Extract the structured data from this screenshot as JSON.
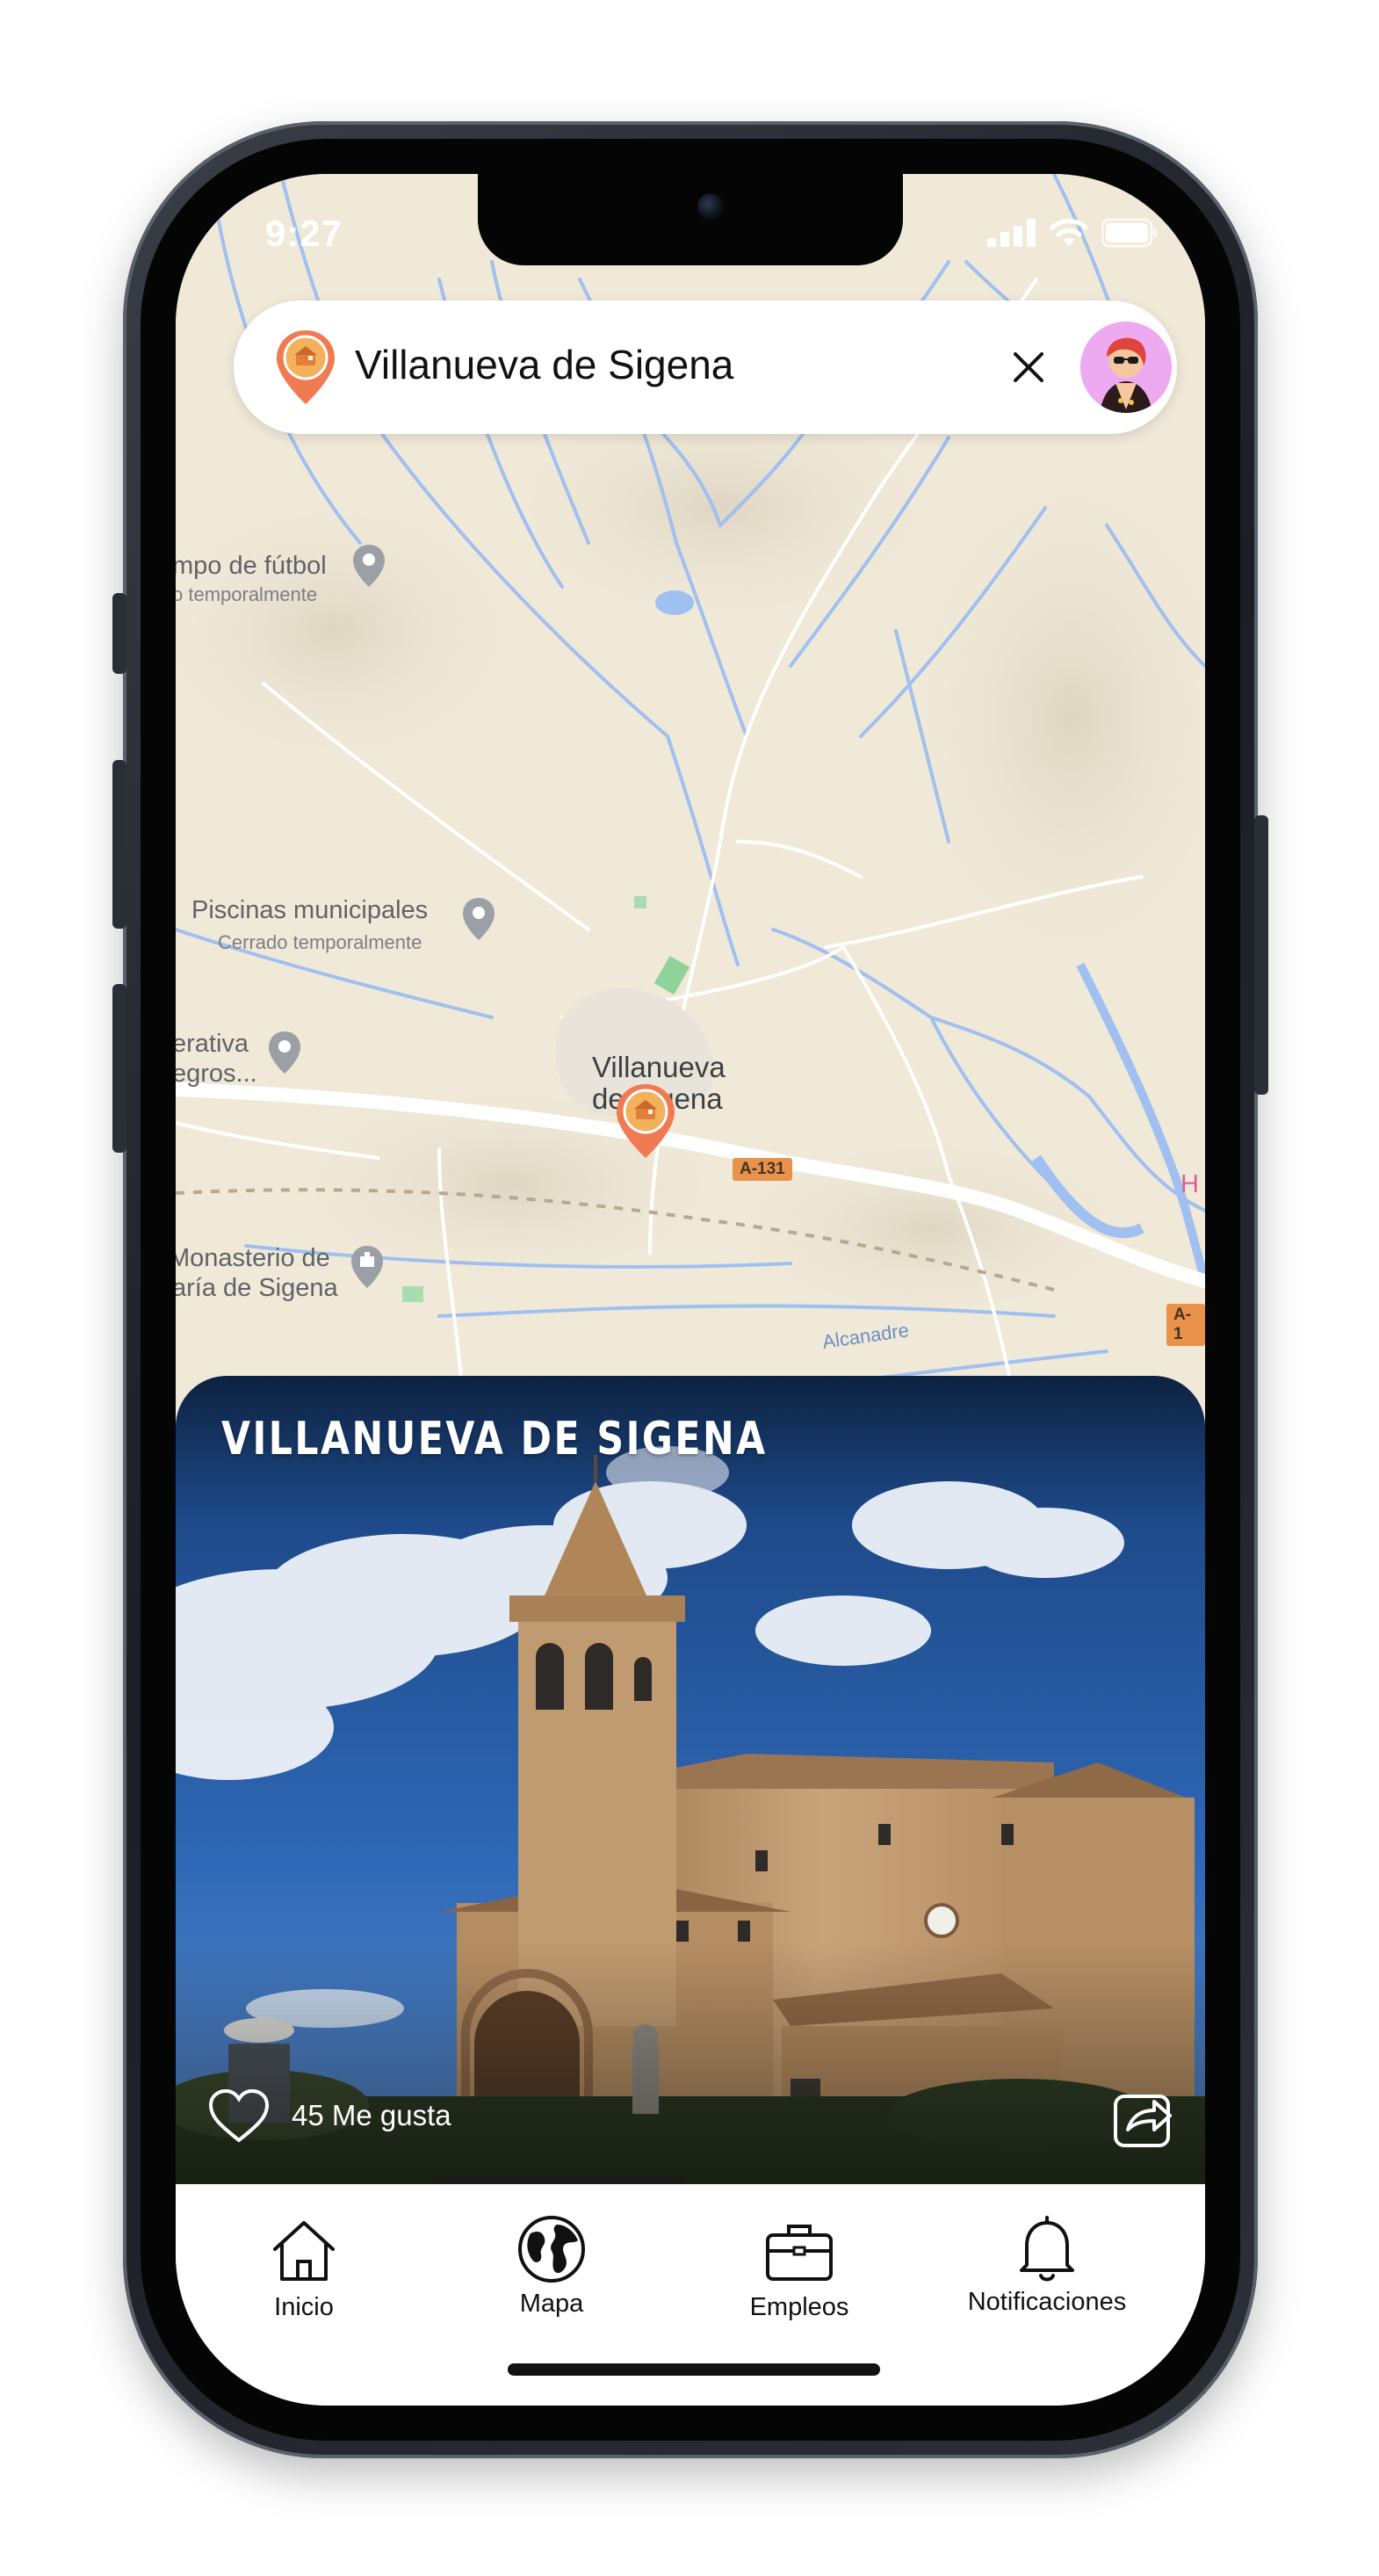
{
  "status_bar": {
    "time": "9:27"
  },
  "search": {
    "query": "Villanueva de Sigena",
    "close_icon": "close-icon",
    "pin_icon": "location-pin-icon"
  },
  "map": {
    "labels": {
      "football": "mpo de fútbol",
      "football_sub": "o temporalmente",
      "pools": "Piscinas municipales",
      "pools_sub": "Cerrado temporalmente",
      "coop_line1": "erativa",
      "coop_line2": "egros...",
      "town_line1": "Villanueva",
      "town_line2": "de Sigena",
      "monastery_line1": "Monasterio de",
      "monastery_line2": "aría de Sigena",
      "river": "Alcanadre",
      "road_1": "A-131",
      "road_2": "A-1",
      "edge_label": "H"
    }
  },
  "place": {
    "title": "VILLANUEVA DE SIGENA",
    "likes": "45 Me gusta"
  },
  "tabs": [
    {
      "label": "Inicio",
      "icon": "home-icon"
    },
    {
      "label": "Mapa",
      "icon": "globe-icon"
    },
    {
      "label": "Empleos",
      "icon": "briefcase-icon"
    },
    {
      "label": "Notificaciones",
      "icon": "bell-icon"
    }
  ],
  "colors": {
    "map_land": "#f1e9d8",
    "map_water": "#9fc0f0",
    "marker_orange": "#f07a52",
    "marker_inner": "#f4b15c",
    "sky": "#2a5fa8"
  }
}
